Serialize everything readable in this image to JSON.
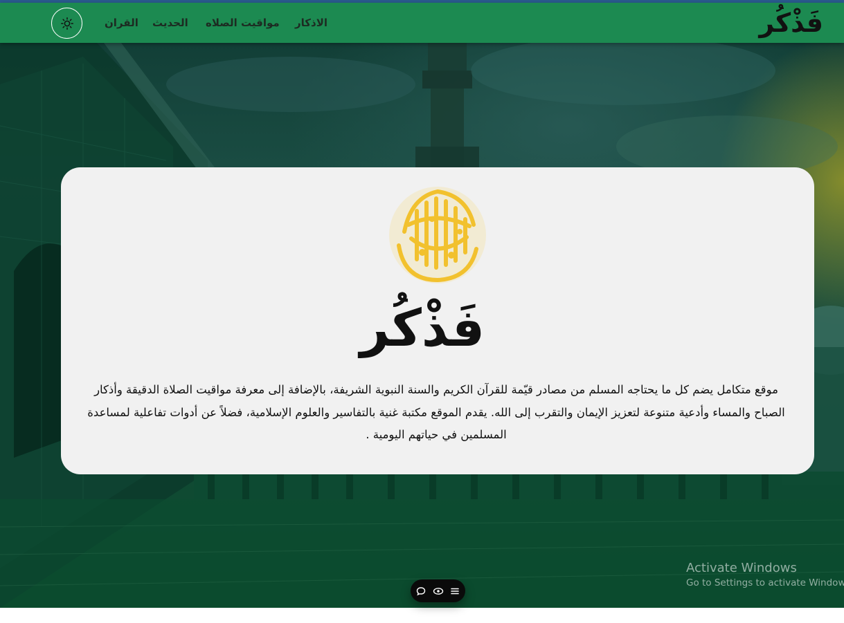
{
  "navbar": {
    "brand": "فَذْكُر",
    "links": {
      "quran": "القران",
      "hadith": "الحديث",
      "prayer_times": "مواقيت الصلاه",
      "azkar": "الاذكار"
    },
    "theme_toggle_icon": "sun-icon"
  },
  "hero": {
    "title": "فَذْكُر",
    "description": "موقع متكامل يضم كل ما يحتاجه المسلم من مصادر قيّمة للقرآن الكريم والسنة النبوية الشريفة، بالإضافة إلى معرفة مواقيت الصلاة الدقيقة وأذكار الصباح والمساء وأدعية متنوعة لتعزيز الإيمان والتقرب إلى الله. يقدم الموقع مكتبة غنية بالتفاسير والعلوم الإسلامية، فضلاً عن أدوات تفاعلية لمساعدة المسلمين في حياتهم اليومية .",
    "seal_icon": "shahada-calligraphy-seal"
  },
  "floating_toolbar": {
    "icons": [
      "chat-bubble-icon",
      "eye-icon",
      "menu-icon"
    ]
  },
  "watermark": {
    "title": "Activate Windows",
    "subtitle": "Go to Settings to activate Windows."
  },
  "colors": {
    "navbar": "#1c8a51",
    "card": "#f1f1f1",
    "seal_gold": "#f2c12e",
    "toolbar": "#0a0a0a"
  }
}
